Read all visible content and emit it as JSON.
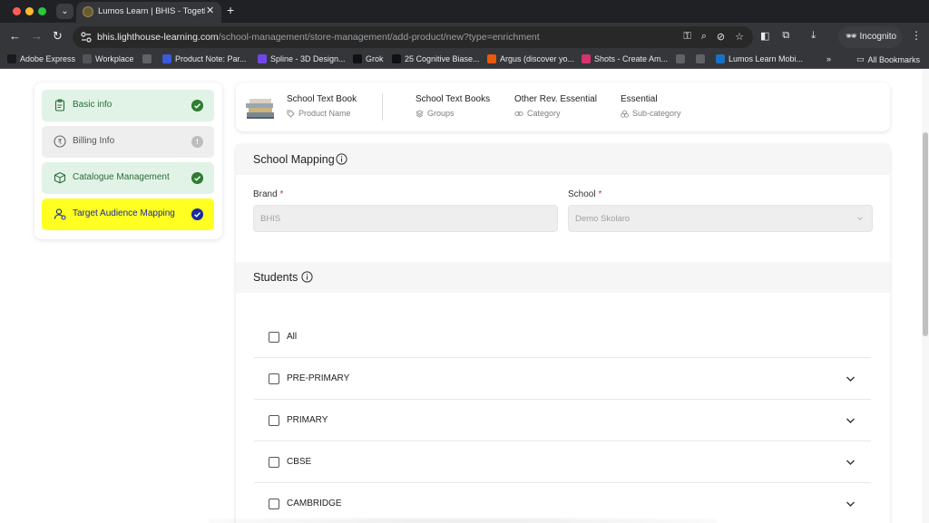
{
  "browser": {
    "tab_title": "Lumos Learn | BHIS - Togethe",
    "url_host": "bhis.lighthouse-learning.com",
    "url_path": "/school-management/store-management/add-product/new?type=enrichment",
    "incognito_label": "Incognito",
    "bookmarks": [
      {
        "label": "Adobe Express",
        "icon": "adobe-express-icon",
        "color": "#1a1a1a"
      },
      {
        "label": "Workplace",
        "icon": "workplace-icon",
        "color": "#555555"
      },
      {
        "label": "",
        "icon": "globe-icon",
        "color": "#5f6368"
      },
      {
        "label": "Product Note: Par...",
        "icon": "product-note-icon",
        "color": "#3b5bdb"
      },
      {
        "label": "Spline - 3D Design...",
        "icon": "spline-icon",
        "color": "#7048e8"
      },
      {
        "label": "Grok",
        "icon": "grok-icon",
        "color": "#111111"
      },
      {
        "label": "25 Cognitive Biase...",
        "icon": "medium-icon",
        "color": "#111111"
      },
      {
        "label": "Argus (discover yo...",
        "icon": "argus-icon",
        "color": "#e8590c"
      },
      {
        "label": "Shots - Create Am...",
        "icon": "shots-icon",
        "color": "#d6336c"
      },
      {
        "label": "",
        "icon": "globe-icon",
        "color": "#5f6368"
      },
      {
        "label": "",
        "icon": "globe-icon",
        "color": "#5f6368"
      },
      {
        "label": "Lumos Learn Mobi...",
        "icon": "lumos-icon",
        "color": "#1971c2"
      }
    ],
    "more_label": "»",
    "all_bookmarks_label": "All Bookmarks"
  },
  "sidebar": {
    "steps": [
      {
        "label": "Basic info",
        "state": "done",
        "icon": "clipboard-icon"
      },
      {
        "label": "Billing Info",
        "state": "pending",
        "icon": "rupee-icon"
      },
      {
        "label": "Catalogue Management",
        "state": "done",
        "icon": "box-icon"
      },
      {
        "label": "Target Audience Mapping",
        "state": "active",
        "icon": "user-target-icon"
      }
    ],
    "pending_mark": "!"
  },
  "summary": {
    "product_name": "School Text Book",
    "product_name_caption": "Product Name",
    "group": "School Text Books",
    "group_caption": "Groups",
    "category": "Other Rev. Essential",
    "category_caption": "Category",
    "sub_category": "Essential",
    "sub_category_caption": "Sub-category"
  },
  "school_mapping": {
    "title": "School Mapping",
    "brand_label": "Brand",
    "brand_value": "BHIS",
    "school_label": "School",
    "school_value": "Demo Skolaro",
    "required_mark": "*"
  },
  "students": {
    "title": "Students",
    "rows": [
      {
        "label": "All",
        "expandable": false
      },
      {
        "label": "PRE-PRIMARY",
        "expandable": true
      },
      {
        "label": "PRIMARY",
        "expandable": true
      },
      {
        "label": "CBSE",
        "expandable": true
      },
      {
        "label": "CAMBRIDGE",
        "expandable": true
      }
    ]
  },
  "colors": {
    "done_bg": "#e1f3e6",
    "done_check": "#2e7d32",
    "active_bg": "#ffff22",
    "active_text": "#1a2ba0",
    "pending_bg": "#eeeeee"
  }
}
